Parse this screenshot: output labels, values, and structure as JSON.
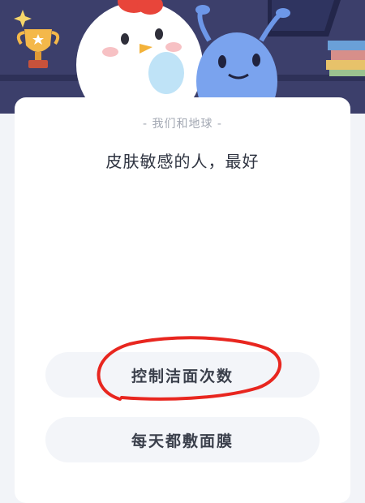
{
  "section_label": "- 我们和地球 -",
  "question": "皮肤敏感的人，最好",
  "options": [
    {
      "label": "控制洁面次数",
      "circled": true
    },
    {
      "label": "每天都敷面膜",
      "circled": false
    }
  ],
  "colors": {
    "banner_bg": "#3c3f6b",
    "annotation_red": "#e8261f"
  },
  "banner_icons": [
    "trophy-icon",
    "sparkle-icon",
    "chicken-mascot",
    "alien-mascot",
    "book-stack-icon"
  ]
}
